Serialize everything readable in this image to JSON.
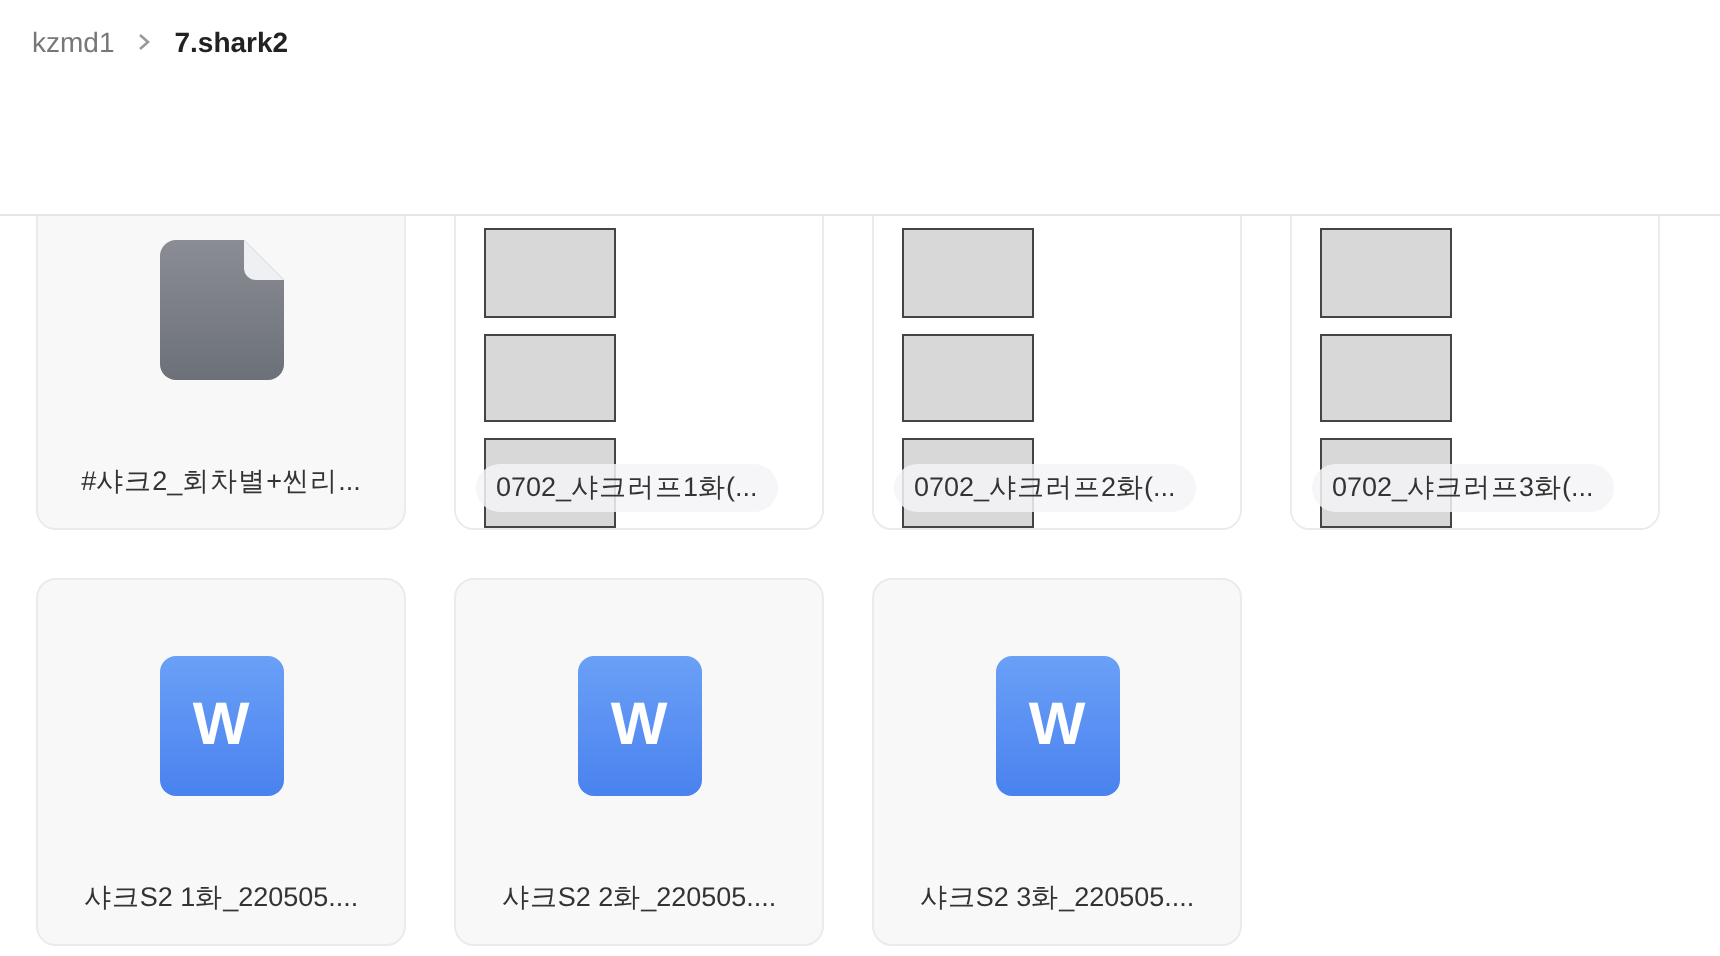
{
  "breadcrumb": [
    {
      "label": "kzmd1",
      "current": false
    },
    {
      "label": "7.shark2",
      "current": true
    }
  ],
  "files": [
    {
      "kind": "file",
      "name": "#샤크2_회차별+씬리..."
    },
    {
      "kind": "image",
      "name": "0702_샤크러프1화(..."
    },
    {
      "kind": "image",
      "name": "0702_샤크러프2화(..."
    },
    {
      "kind": "image",
      "name": "0702_샤크러프3화(..."
    },
    {
      "kind": "word",
      "icon_text": "W",
      "name": "샤크S2 1화_220505...."
    },
    {
      "kind": "word",
      "icon_text": "W",
      "name": "샤크S2 2화_220505...."
    },
    {
      "kind": "word",
      "icon_text": "W",
      "name": "샤크S2 3화_220505...."
    }
  ]
}
